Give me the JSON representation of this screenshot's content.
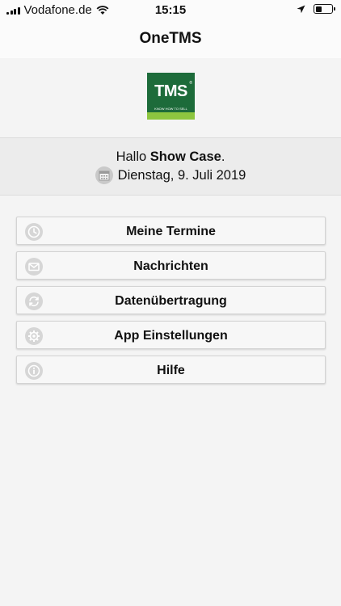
{
  "status_bar": {
    "carrier": "Vodafone.de",
    "time": "15:15",
    "battery_level": 0.4
  },
  "navbar": {
    "title": "OneTMS"
  },
  "logo": {
    "text": "TMS",
    "tagline": "KNOW HOW TO SELL",
    "colors": {
      "primary": "#1d6b3a",
      "accent": "#8dc63f"
    }
  },
  "greeting": {
    "prefix": "Hallo ",
    "name": "Show Case",
    "suffix": ".",
    "date": "Dienstag, 9. Juli 2019"
  },
  "menu": {
    "items": [
      {
        "label": "Meine Termine",
        "icon": "clock-icon"
      },
      {
        "label": "Nachrichten",
        "icon": "envelope-icon"
      },
      {
        "label": "Datenübertragung",
        "icon": "sync-icon"
      },
      {
        "label": "App Einstellungen",
        "icon": "gear-icon"
      },
      {
        "label": "Hilfe",
        "icon": "info-icon"
      }
    ]
  }
}
